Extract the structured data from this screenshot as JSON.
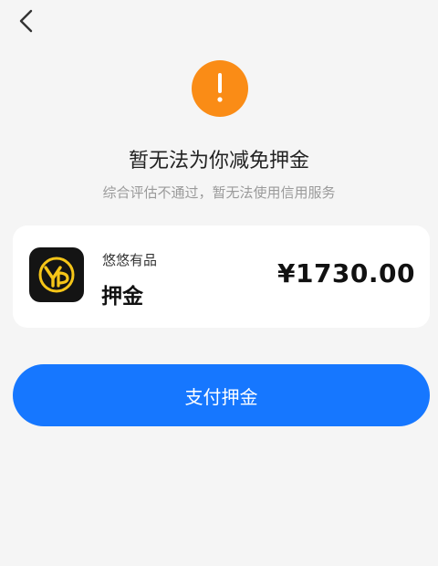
{
  "nav": {
    "back_icon": "chevron-left-icon"
  },
  "status": {
    "icon": "warning-exclamation-icon",
    "icon_color": "#fa8c16",
    "title": "暂无法为你减免押金",
    "subtitle": "综合评估不通过，暂无法使用信用服务"
  },
  "deposit": {
    "merchant": "悠悠有品",
    "item": "押金",
    "amount": "¥1730.00",
    "logo_icon": "youyou-logo-icon"
  },
  "action": {
    "pay_label": "支付押金",
    "accent": "#1677ff"
  }
}
